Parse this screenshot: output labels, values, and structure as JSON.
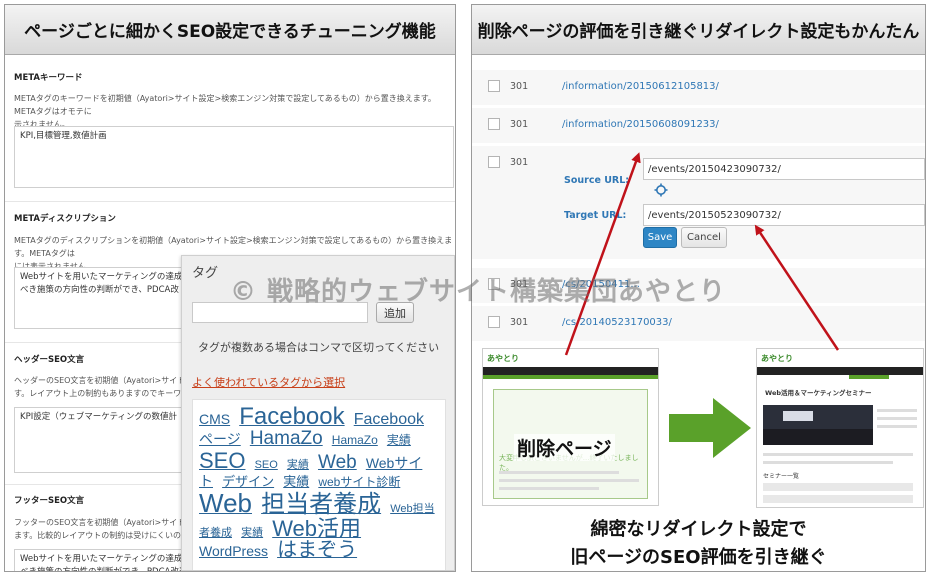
{
  "left": {
    "title": "ページごとに細かくSEO設定できるチューニング機能",
    "sections": [
      {
        "label": "METAキーワード",
        "desc": "METAタグのキーワードを初期値（Ayatori>サイト設定>検索エンジン対策で設定してあるもの）から置き換えます。METAタグはオモテに\n示されません。",
        "value": "KPI,目標管理,数値計画"
      },
      {
        "label": "METAディスクリプション",
        "desc": "METAタグのディスクリプションを初期値（Ayatori>サイト設定>検索エンジン対策で設定してあるもの）から置き換えます。METAタグは\nには表示されません。",
        "value": "Webサイトを用いたマーケティングの達成\nべき施策の方向性の判断ができ、PDCA改"
      },
      {
        "label": "ヘッダーSEO文言",
        "desc": "ヘッダーのSEO文言を初期値（Ayatori>サイト\nす。レイアウト上の制約もありますのでキーワ",
        "value": "KPI設定（ウェブマーケティングの数値計"
      },
      {
        "label": "フッターSEO文言",
        "desc": "フッターのSEO文言を初期値（Ayatori>サイト\nます。比較的レイアウトの制約は受けにくいのでキ",
        "value": "Webサイトを用いたマーケティングの達成\nべき施策の方向性の判断ができ、PDCA改善を効果的に推し進めることができます。"
      }
    ],
    "tag_box": {
      "title": "タグ",
      "add_label": "追加",
      "hint": "タグが複数ある場合はコンマで区切ってください",
      "popular_link": "よく使われているタグから選択",
      "tags": [
        {
          "text": "CMS",
          "size": 14
        },
        {
          "text": "Facebook",
          "size": 24
        },
        {
          "text": "Facebook",
          "size": 16
        },
        {
          "text": "ページ",
          "size": 14
        },
        {
          "text": "HamaZo",
          "size": 19
        },
        {
          "text": "HamaZo",
          "size": 12
        },
        {
          "text": "実績",
          "size": 12
        },
        {
          "text": "SEO",
          "size": 22
        },
        {
          "text": "SEO",
          "size": 11
        },
        {
          "text": "実績",
          "size": 11
        },
        {
          "text": "Web",
          "size": 19
        },
        {
          "text": "Webサイト",
          "size": 14
        },
        {
          "text": "デザイン",
          "size": 13
        },
        {
          "text": "実績",
          "size": 13
        },
        {
          "text": "webサイト診断",
          "size": 12
        },
        {
          "text": "Web",
          "size": 26
        },
        {
          "text": "担当者養成",
          "size": 24
        },
        {
          "text": "Web担当者養成",
          "size": 11
        },
        {
          "text": "実績",
          "size": 11
        },
        {
          "text": "Web活用",
          "size": 22
        },
        {
          "text": "WordPress",
          "size": 14
        },
        {
          "text": "はまぞう",
          "size": 20
        }
      ]
    }
  },
  "right": {
    "title": "削除ページの評価を引き継ぐリダイレクト設定もかんたん",
    "rows": [
      {
        "code": "301",
        "url": "/information/20150612105813/"
      },
      {
        "code": "301",
        "url": "/information/20150608091233/"
      },
      {
        "code": "301"
      },
      {
        "code": "301",
        "url": "/cs/20150411..."
      },
      {
        "code": "301",
        "url": "/cs/20140523170033/"
      }
    ],
    "editor": {
      "source_label": "Source URL:",
      "source_value": "/events/20150423090732/",
      "target_label": "Target URL:",
      "target_value": "/events/20150523090732/",
      "save_label": "Save",
      "cancel_label": "Cancel"
    },
    "deleted_label": "削除ページ",
    "caption_line1": "綿密なリダイレクト設定で",
    "caption_line2": "旧ページのSEO評価を引き継ぐ",
    "old_thumb_text": "大変申し訳ございませんが...終了いたしました。",
    "new_thumb_title": "Web活用＆マーケティングセミナー",
    "new_thumb_section": "セミナー一覧",
    "thumb_logo": "あやとり"
  },
  "watermark": "© 戦略的ウェブサイト構築集団あやとり",
  "colors": {
    "link": "#2f77b5",
    "save": "#2e86c5",
    "arrow_green": "#5aa12a",
    "arrow_red": "#c0121a",
    "popular_link": "#c8401a"
  }
}
